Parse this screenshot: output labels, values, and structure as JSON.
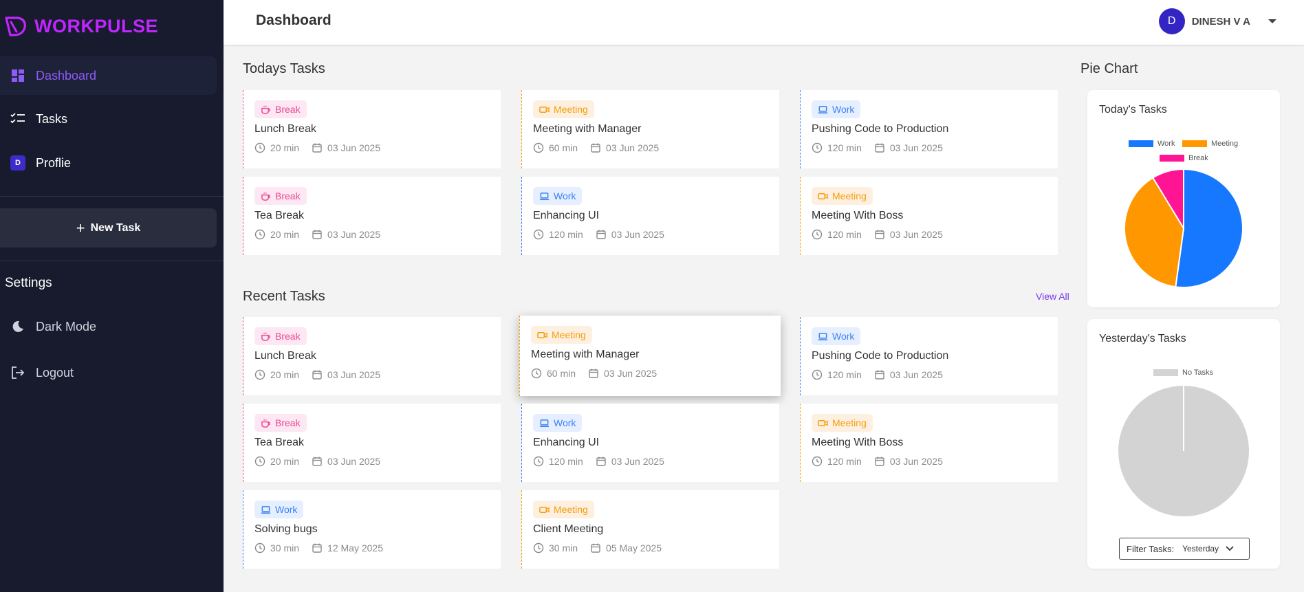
{
  "brand": {
    "name": "WORKPULSE",
    "color": "#c026ff"
  },
  "sidebar": {
    "items": [
      {
        "label": "Dashboard",
        "icon": "dashboard-icon",
        "active": true
      },
      {
        "label": "Tasks",
        "icon": "checklist-icon"
      },
      {
        "label": "Proflie",
        "icon": "profile-badge",
        "badge": "D"
      }
    ],
    "new_task_label": "New Task",
    "settings_title": "Settings",
    "dark_mode_label": "Dark Mode",
    "logout_label": "Logout"
  },
  "header": {
    "title": "Dashboard",
    "user_initial": "D",
    "user_name": "DINESH V A"
  },
  "todays": {
    "title": "Todays Tasks",
    "cards": [
      {
        "category": "Break",
        "title": "Lunch Break",
        "duration": "20 min",
        "date": "03 Jun 2025"
      },
      {
        "category": "Meeting",
        "title": "Meeting with Manager",
        "duration": "60 min",
        "date": "03 Jun 2025"
      },
      {
        "category": "Work",
        "title": "Pushing Code to Production",
        "duration": "120 min",
        "date": "03 Jun 2025"
      },
      {
        "category": "Break",
        "title": "Tea Break",
        "duration": "20 min",
        "date": "03 Jun 2025"
      },
      {
        "category": "Work",
        "title": "Enhancing UI",
        "duration": "120 min",
        "date": "03 Jun 2025"
      },
      {
        "category": "Meeting",
        "title": "Meeting With Boss",
        "duration": "120 min",
        "date": "03 Jun 2025"
      }
    ]
  },
  "recent": {
    "title": "Recent Tasks",
    "view_all": "View All",
    "cards": [
      {
        "category": "Break",
        "title": "Lunch Break",
        "duration": "20 min",
        "date": "03 Jun 2025"
      },
      {
        "category": "Meeting",
        "title": "Meeting with Manager",
        "duration": "60 min",
        "date": "03 Jun 2025"
      },
      {
        "category": "Work",
        "title": "Pushing Code to Production",
        "duration": "120 min",
        "date": "03 Jun 2025"
      },
      {
        "category": "Break",
        "title": "Tea Break",
        "duration": "20 min",
        "date": "03 Jun 2025"
      },
      {
        "category": "Work",
        "title": "Enhancing UI",
        "duration": "120 min",
        "date": "03 Jun 2025"
      },
      {
        "category": "Meeting",
        "title": "Meeting With Boss",
        "duration": "120 min",
        "date": "03 Jun 2025"
      },
      {
        "category": "Work",
        "title": "Solving bugs",
        "duration": "30 min",
        "date": "12 May 2025"
      },
      {
        "category": "Meeting",
        "title": "Client Meeting",
        "duration": "30 min",
        "date": "05 May 2025"
      }
    ]
  },
  "pie": {
    "section_title": "Pie Chart",
    "filter_label": "Filter Tasks:",
    "filter_value": "Yesterday"
  },
  "colors": {
    "work": "#1677ff",
    "meeting": "#ff9800",
    "break": "#ff1493",
    "empty": "#d3d3d3",
    "accent": "#7c3aed"
  },
  "chart_data": [
    {
      "type": "pie",
      "title": "Today's Tasks",
      "categories": [
        "Work",
        "Meeting",
        "Break"
      ],
      "values": [
        240,
        180,
        40
      ]
    },
    {
      "type": "pie",
      "title": "Yesterday's Tasks",
      "categories": [
        "No Tasks"
      ],
      "values": [
        1
      ]
    }
  ]
}
